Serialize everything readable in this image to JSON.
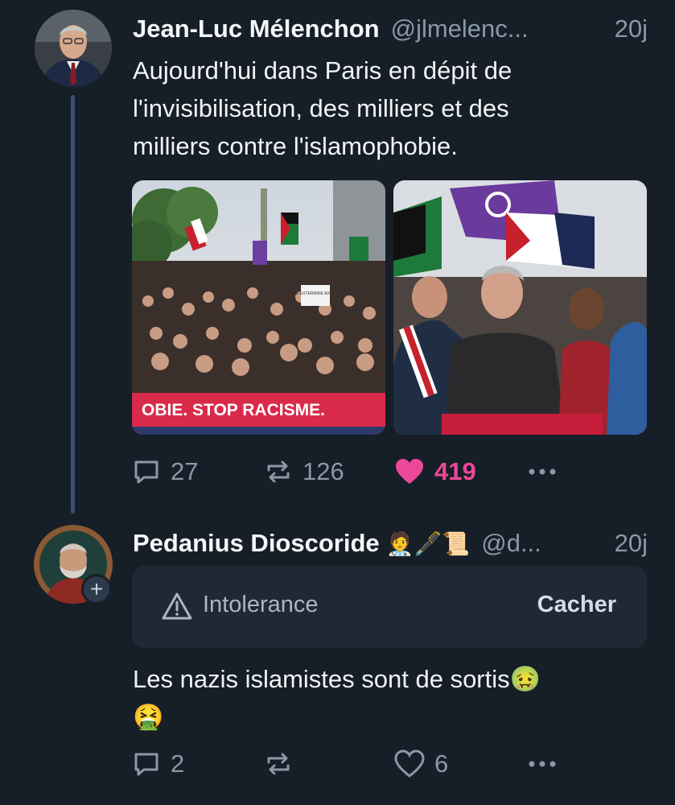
{
  "post": {
    "author_name": "Jean-Luc Mélenchon",
    "handle": "@jlmelenc...",
    "time": "20j",
    "text_lines": [
      "Aujourd'hui dans Paris en dépit de",
      "l'invisibilisation, des milliers et des",
      "milliers contre l'islamophobie."
    ],
    "banner_text": "OBIE. STOP RACISME.",
    "sign_text": "LE RACISME EXTERMINE AVEC DOUCEUR",
    "replies": "27",
    "reposts": "126",
    "likes": "419",
    "liked": true,
    "colors": {
      "like": "#ec4899",
      "muted": "#8a98a8",
      "background": "#161e27"
    }
  },
  "reply": {
    "author_name": "Pedanius Dioscoride",
    "name_emoji": "🧑‍⚕️🖋️📜",
    "handle": "@d...",
    "time": "20j",
    "warning_label": "Intolerance",
    "hide_label": "Cacher",
    "text_line1": "Les nazis islamistes sont de sortis🤢",
    "text_line2": "🤮",
    "replies": "2",
    "likes": "6",
    "follow_badge": "+"
  },
  "icons": [
    "reply-icon",
    "repost-icon",
    "heart-icon",
    "more-icon",
    "warning-icon"
  ]
}
